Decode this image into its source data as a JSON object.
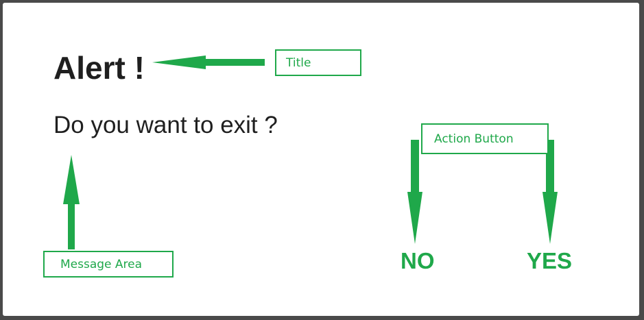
{
  "dialog": {
    "title": "Alert !",
    "message": "Do you want to exit ?",
    "buttons": {
      "no": "NO",
      "yes": "YES"
    }
  },
  "annotations": {
    "title": "Title",
    "action_button": "Action Button",
    "message_area": "Message Area"
  },
  "colors": {
    "annotation": "#1fa84a",
    "text": "#1f1f1f",
    "backdrop": "#4a4a4a"
  }
}
